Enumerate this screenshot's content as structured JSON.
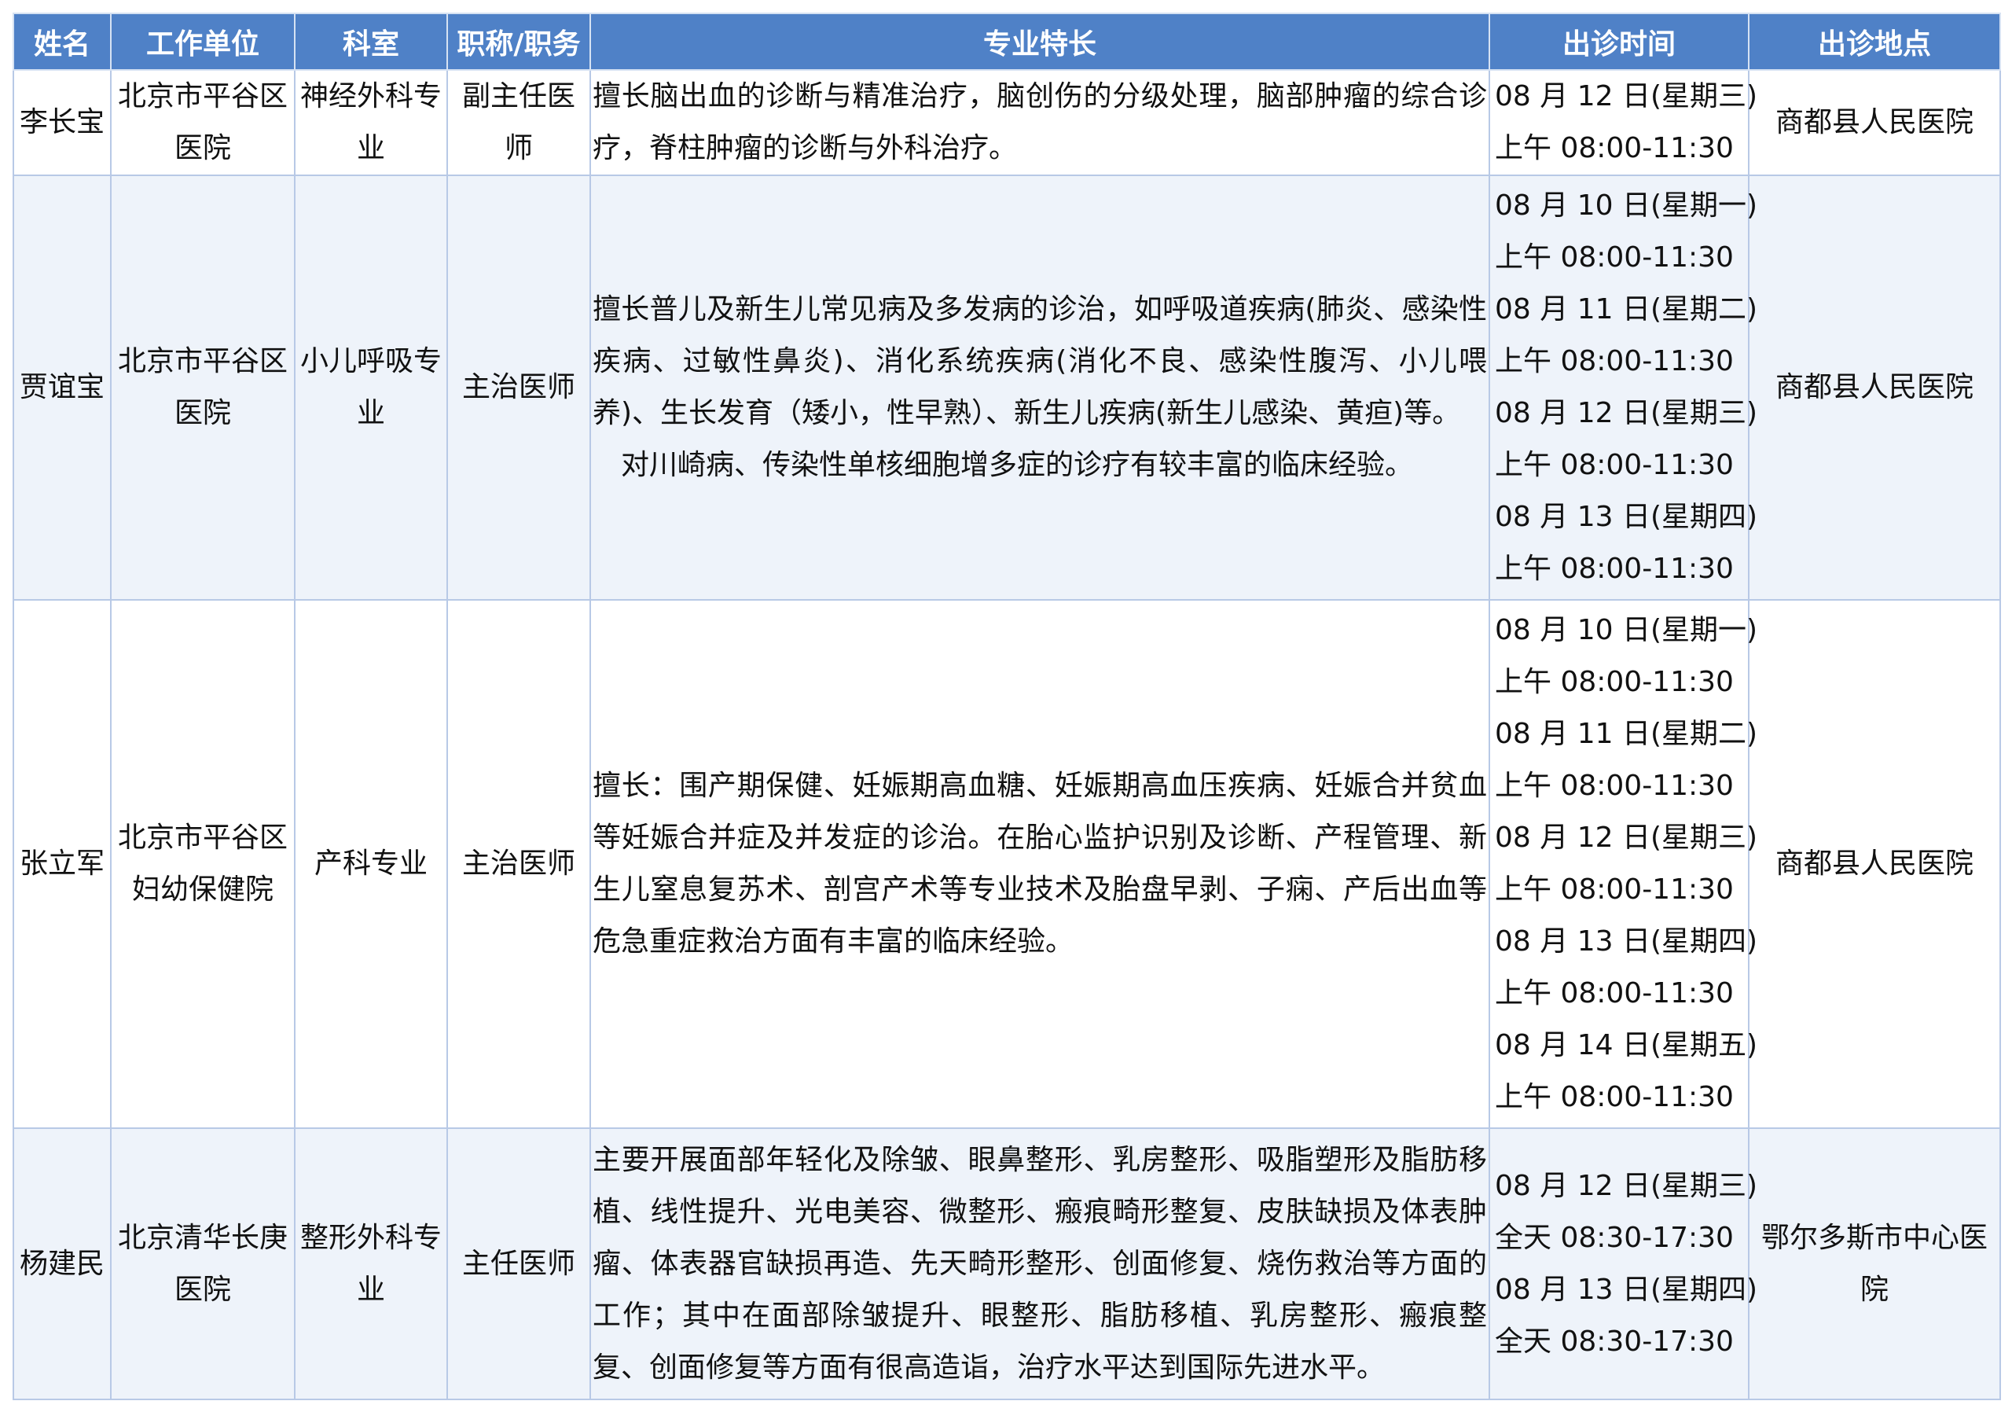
{
  "headers": {
    "name": "姓名",
    "unit": "工作单位",
    "dept": "科室",
    "title": "职称/职务",
    "specialty": "专业特长",
    "time": "出诊时间",
    "place": "出诊地点"
  },
  "rows": [
    {
      "name": "李长宝",
      "unit": "北京市平谷区医院",
      "dept": "神经外科专业",
      "title": "副主任医师",
      "specialty": "擅长脑出血的诊断与精准治疗，脑创伤的分级处理，脑部肿瘤的综合诊疗，脊柱肿瘤的诊断与外科治疗。",
      "specialty_extra": "",
      "schedule": [
        "08 月 12 日(星期三)",
        "上午 08:00-11:30"
      ],
      "place": "商都县人民医院"
    },
    {
      "name": "贾谊宝",
      "unit": "北京市平谷区医院",
      "dept": "小儿呼吸专业",
      "title": "主治医师",
      "specialty": "擅长普儿及新生儿常见病及多发病的诊治，如呼吸道疾病(肺炎、感染性疾病、过敏性鼻炎)、消化系统疾病(消化不良、感染性腹泻、小儿喂养)、生长发育（矮小，性早熟）、新生儿疾病(新生儿感染、黄疸)等。",
      "specialty_extra": "对川崎病、传染性单核细胞增多症的诊疗有较丰富的临床经验。",
      "schedule": [
        "08 月 10 日(星期一)",
        "上午 08:00-11:30",
        "08 月 11 日(星期二)",
        "上午 08:00-11:30",
        "08 月 12 日(星期三)",
        "上午 08:00-11:30",
        "08 月 13 日(星期四)",
        "上午 08:00-11:30"
      ],
      "place": "商都县人民医院"
    },
    {
      "name": "张立军",
      "unit": "北京市平谷区妇幼保健院",
      "dept": "产科专业",
      "title": "主治医师",
      "specialty": "擅长：围产期保健、妊娠期高血糖、妊娠期高血压疾病、妊娠合并贫血等妊娠合并症及并发症的诊治。在胎心监护识别及诊断、产程管理、新生儿窒息复苏术、剖宫产术等专业技术及胎盘早剥、子痫、产后出血等危急重症救治方面有丰富的临床经验。",
      "specialty_extra": "",
      "schedule": [
        "08 月 10 日(星期一)",
        "上午 08:00-11:30",
        "08 月 11 日(星期二)",
        "上午 08:00-11:30",
        "08 月 12 日(星期三)",
        "上午 08:00-11:30",
        "08 月 13 日(星期四)",
        "上午 08:00-11:30",
        "08 月 14 日(星期五)",
        "上午 08:00-11:30"
      ],
      "place": "商都县人民医院"
    },
    {
      "name": "杨建民",
      "unit": "北京清华长庚医院",
      "dept": "整形外科专业",
      "title": "主任医师",
      "specialty": "主要开展面部年轻化及除皱、眼鼻整形、乳房整形、吸脂塑形及脂肪移植、线性提升、光电美容、微整形、瘢痕畸形整复、皮肤缺损及体表肿瘤、体表器官缺损再造、先天畸形整形、创面修复、烧伤救治等方面的工作；其中在面部除皱提升、眼整形、脂肪移植、乳房整形、瘢痕整复、创面修复等方面有很高造诣，治疗水平达到国际先进水平。",
      "specialty_extra": "",
      "schedule": [
        "08 月 12 日(星期三)",
        "全天 08:30-17:30",
        "08 月 13 日(星期四)",
        "全天 08:30-17:30"
      ],
      "place": "鄂尔多斯市中心医院"
    }
  ]
}
